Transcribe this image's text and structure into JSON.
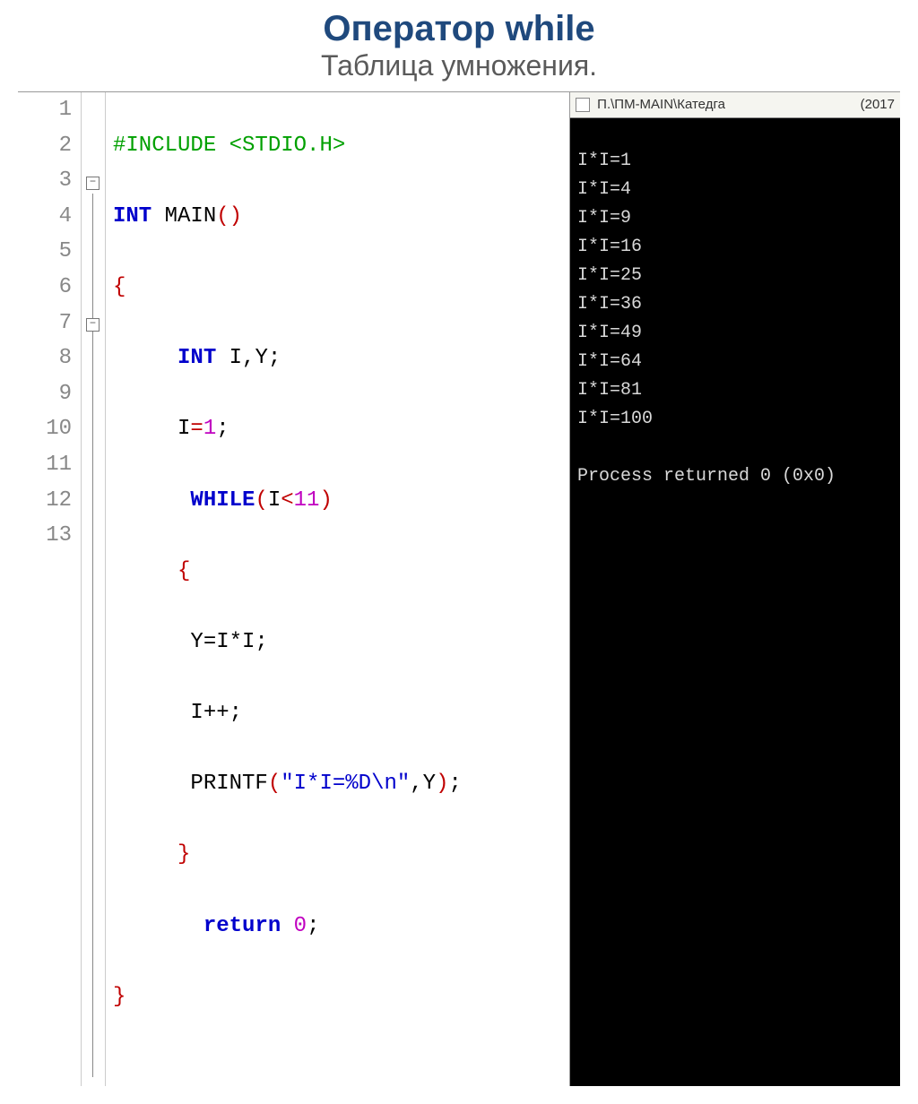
{
  "title": "Оператор while",
  "subtitle": "Таблица умножения.",
  "code": {
    "line_numbers": [
      "1",
      "2",
      "3",
      "4",
      "5",
      "6",
      "7",
      "8",
      "9",
      "10",
      "11",
      "12",
      "13"
    ],
    "l1_pre": "#INCLUDE <STDIO.H>",
    "l2_a": "INT",
    "l2_b": " MAIN",
    "l2_c": "()",
    "l3": "{",
    "l4_a": "INT",
    "l4_b": " I,Y;",
    "l5_a": "I",
    "l5_b": "=",
    "l5_c": "1",
    "l5_d": ";",
    "l6_a": "WHILE",
    "l6_b": "(",
    "l6_c": "I",
    "l6_d": "<",
    "l6_e": "11",
    "l6_f": ")",
    "l7": "{",
    "l8": "Y=I*I;",
    "l9": "I++;",
    "l10_a": "PRINTF",
    "l10_b": "(",
    "l10_c": "\"I*I=%D\\n\"",
    "l10_d": ",Y",
    "l10_e": ")",
    "l10_f": ";",
    "l11": "}",
    "l12_a": "return",
    "l12_b": " 0",
    "l12_c": ";",
    "l13": "}"
  },
  "console": {
    "title_text": "П.\\ПМ-МАIN\\Катедга",
    "title_suffix": "(2017",
    "lines": [
      "I*I=1",
      "I*I=4",
      "I*I=9",
      "I*I=16",
      "I*I=25",
      "I*I=36",
      "I*I=49",
      "I*I=64",
      "I*I=81",
      "I*I=100"
    ],
    "footer": "Process returned 0 (0x0)"
  },
  "fold_minus": "−"
}
